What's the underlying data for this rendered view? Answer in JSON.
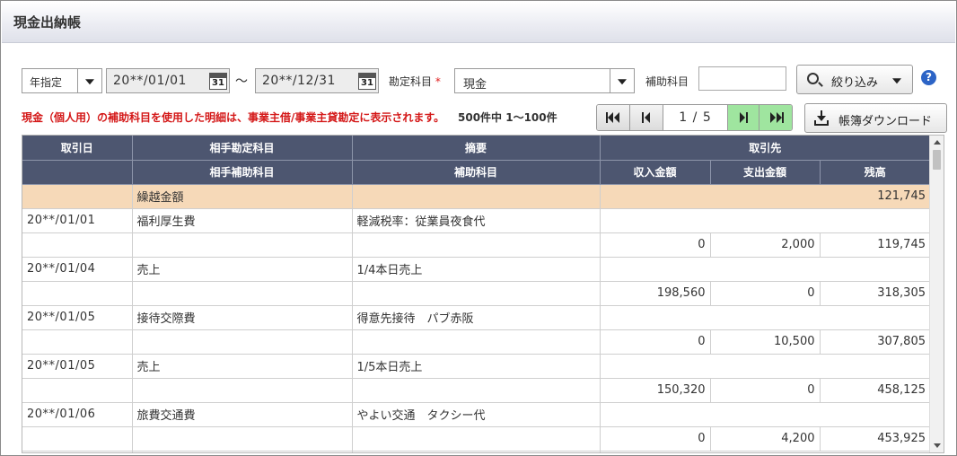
{
  "header": {
    "title": "現金出納帳"
  },
  "filters": {
    "period_mode": "年指定",
    "date_from": "20**/01/01",
    "date_to": "20**/12/31",
    "calendar_day": "31",
    "range_sep": "～",
    "account_label": "勘定科目",
    "required_mark": "*",
    "account_value": "現金",
    "sub_account_label": "補助科目",
    "sub_account_value": "",
    "filter_button": "絞り込み",
    "help": "?"
  },
  "notice": "現金（個人用）の補助科目を使用した明細は、事業主借/事業主貸勘定に表示されます。",
  "count": "500件中 1～100件",
  "pager": {
    "current": "1",
    "sep": "/",
    "total": "5"
  },
  "download_button": "帳簿ダウンロード",
  "table": {
    "header_row1": [
      "取引日",
      "相手勘定科目",
      "摘要",
      "取引先"
    ],
    "header_row2": [
      "",
      "相手補助科目",
      "補助科目",
      "収入金額",
      "支出金額",
      "残高"
    ],
    "carry_over": {
      "label": "繰越金額",
      "balance": "121,745"
    },
    "entries": [
      {
        "date": "20**/01/01",
        "account": "福利厚生費",
        "summary": "軽減税率：従業員夜食代",
        "sub_account": "",
        "sub_item": "",
        "income": "0",
        "expense": "2,000",
        "balance": "119,745"
      },
      {
        "date": "20**/01/04",
        "account": "売上",
        "summary": "1/4本日売上",
        "sub_account": "",
        "sub_item": "",
        "income": "198,560",
        "expense": "0",
        "balance": "318,305"
      },
      {
        "date": "20**/01/05",
        "account": "接待交際費",
        "summary": "得意先接待　パブ赤阪",
        "sub_account": "",
        "sub_item": "",
        "income": "0",
        "expense": "10,500",
        "balance": "307,805"
      },
      {
        "date": "20**/01/05",
        "account": "売上",
        "summary": "1/5本日売上",
        "sub_account": "",
        "sub_item": "",
        "income": "150,320",
        "expense": "0",
        "balance": "458,125"
      },
      {
        "date": "20**/01/06",
        "account": "旅費交通費",
        "summary": "やよい交通　タクシー代",
        "sub_account": "",
        "sub_item": "",
        "income": "0",
        "expense": "4,200",
        "balance": "453,925"
      }
    ]
  },
  "colors": {
    "header_bg": "#4d5670",
    "carry_bg": "#f6d9b8",
    "notice": "#d41818",
    "pager_active": "#9fe59f"
  }
}
